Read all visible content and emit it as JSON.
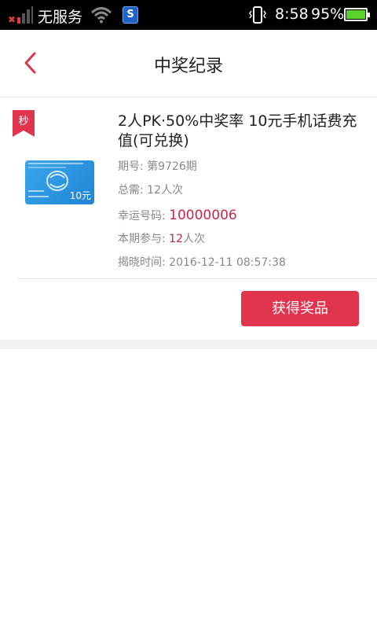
{
  "status_bar": {
    "carrier": "无服务",
    "time": "8:58",
    "battery_percent": "95%",
    "battery_level": 0.95,
    "app_icon_letter": "S",
    "signal_icon": "no-signal-icon",
    "wifi_icon": "wifi-icon",
    "vibrate_icon": "vibrate-icon",
    "battery_color": "#5bd12d"
  },
  "header": {
    "title": "中奖纪录",
    "back_icon": "chevron-left-icon",
    "accent_color": "#e0344f"
  },
  "record": {
    "badge_label": "秒",
    "thumbnail_amount": "10元",
    "product_name": "2人PK·50%中奖率 10元手机话费充值(可兑换)",
    "period_label": "期号:",
    "period_value": "第9726期",
    "total_label": "总需:",
    "total_value": "12人次",
    "lucky_label": "幸运号码:",
    "lucky_value": "10000006",
    "joined_label": "本期参与:",
    "joined_count": "12",
    "joined_unit": "人次",
    "reveal_label": "揭晓时间:",
    "reveal_value": "2016-12-11 08:57:38",
    "action_label": "获得奖品"
  }
}
